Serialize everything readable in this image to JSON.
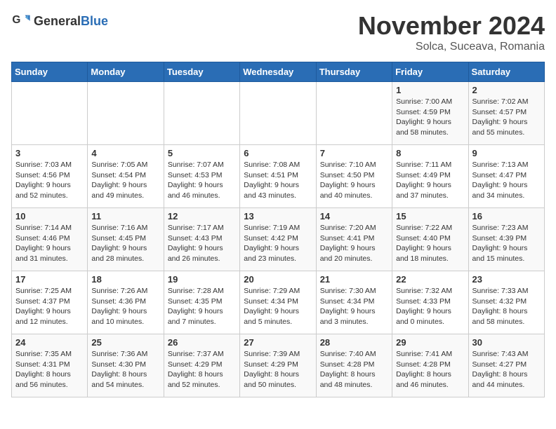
{
  "header": {
    "logo_general": "General",
    "logo_blue": "Blue",
    "month": "November 2024",
    "location": "Solca, Suceava, Romania"
  },
  "days_of_week": [
    "Sunday",
    "Monday",
    "Tuesday",
    "Wednesday",
    "Thursday",
    "Friday",
    "Saturday"
  ],
  "weeks": [
    [
      {
        "day": "",
        "info": ""
      },
      {
        "day": "",
        "info": ""
      },
      {
        "day": "",
        "info": ""
      },
      {
        "day": "",
        "info": ""
      },
      {
        "day": "",
        "info": ""
      },
      {
        "day": "1",
        "info": "Sunrise: 7:00 AM\nSunset: 4:59 PM\nDaylight: 9 hours and 58 minutes."
      },
      {
        "day": "2",
        "info": "Sunrise: 7:02 AM\nSunset: 4:57 PM\nDaylight: 9 hours and 55 minutes."
      }
    ],
    [
      {
        "day": "3",
        "info": "Sunrise: 7:03 AM\nSunset: 4:56 PM\nDaylight: 9 hours and 52 minutes."
      },
      {
        "day": "4",
        "info": "Sunrise: 7:05 AM\nSunset: 4:54 PM\nDaylight: 9 hours and 49 minutes."
      },
      {
        "day": "5",
        "info": "Sunrise: 7:07 AM\nSunset: 4:53 PM\nDaylight: 9 hours and 46 minutes."
      },
      {
        "day": "6",
        "info": "Sunrise: 7:08 AM\nSunset: 4:51 PM\nDaylight: 9 hours and 43 minutes."
      },
      {
        "day": "7",
        "info": "Sunrise: 7:10 AM\nSunset: 4:50 PM\nDaylight: 9 hours and 40 minutes."
      },
      {
        "day": "8",
        "info": "Sunrise: 7:11 AM\nSunset: 4:49 PM\nDaylight: 9 hours and 37 minutes."
      },
      {
        "day": "9",
        "info": "Sunrise: 7:13 AM\nSunset: 4:47 PM\nDaylight: 9 hours and 34 minutes."
      }
    ],
    [
      {
        "day": "10",
        "info": "Sunrise: 7:14 AM\nSunset: 4:46 PM\nDaylight: 9 hours and 31 minutes."
      },
      {
        "day": "11",
        "info": "Sunrise: 7:16 AM\nSunset: 4:45 PM\nDaylight: 9 hours and 28 minutes."
      },
      {
        "day": "12",
        "info": "Sunrise: 7:17 AM\nSunset: 4:43 PM\nDaylight: 9 hours and 26 minutes."
      },
      {
        "day": "13",
        "info": "Sunrise: 7:19 AM\nSunset: 4:42 PM\nDaylight: 9 hours and 23 minutes."
      },
      {
        "day": "14",
        "info": "Sunrise: 7:20 AM\nSunset: 4:41 PM\nDaylight: 9 hours and 20 minutes."
      },
      {
        "day": "15",
        "info": "Sunrise: 7:22 AM\nSunset: 4:40 PM\nDaylight: 9 hours and 18 minutes."
      },
      {
        "day": "16",
        "info": "Sunrise: 7:23 AM\nSunset: 4:39 PM\nDaylight: 9 hours and 15 minutes."
      }
    ],
    [
      {
        "day": "17",
        "info": "Sunrise: 7:25 AM\nSunset: 4:37 PM\nDaylight: 9 hours and 12 minutes."
      },
      {
        "day": "18",
        "info": "Sunrise: 7:26 AM\nSunset: 4:36 PM\nDaylight: 9 hours and 10 minutes."
      },
      {
        "day": "19",
        "info": "Sunrise: 7:28 AM\nSunset: 4:35 PM\nDaylight: 9 hours and 7 minutes."
      },
      {
        "day": "20",
        "info": "Sunrise: 7:29 AM\nSunset: 4:34 PM\nDaylight: 9 hours and 5 minutes."
      },
      {
        "day": "21",
        "info": "Sunrise: 7:30 AM\nSunset: 4:34 PM\nDaylight: 9 hours and 3 minutes."
      },
      {
        "day": "22",
        "info": "Sunrise: 7:32 AM\nSunset: 4:33 PM\nDaylight: 9 hours and 0 minutes."
      },
      {
        "day": "23",
        "info": "Sunrise: 7:33 AM\nSunset: 4:32 PM\nDaylight: 8 hours and 58 minutes."
      }
    ],
    [
      {
        "day": "24",
        "info": "Sunrise: 7:35 AM\nSunset: 4:31 PM\nDaylight: 8 hours and 56 minutes."
      },
      {
        "day": "25",
        "info": "Sunrise: 7:36 AM\nSunset: 4:30 PM\nDaylight: 8 hours and 54 minutes."
      },
      {
        "day": "26",
        "info": "Sunrise: 7:37 AM\nSunset: 4:29 PM\nDaylight: 8 hours and 52 minutes."
      },
      {
        "day": "27",
        "info": "Sunrise: 7:39 AM\nSunset: 4:29 PM\nDaylight: 8 hours and 50 minutes."
      },
      {
        "day": "28",
        "info": "Sunrise: 7:40 AM\nSunset: 4:28 PM\nDaylight: 8 hours and 48 minutes."
      },
      {
        "day": "29",
        "info": "Sunrise: 7:41 AM\nSunset: 4:28 PM\nDaylight: 8 hours and 46 minutes."
      },
      {
        "day": "30",
        "info": "Sunrise: 7:43 AM\nSunset: 4:27 PM\nDaylight: 8 hours and 44 minutes."
      }
    ]
  ]
}
